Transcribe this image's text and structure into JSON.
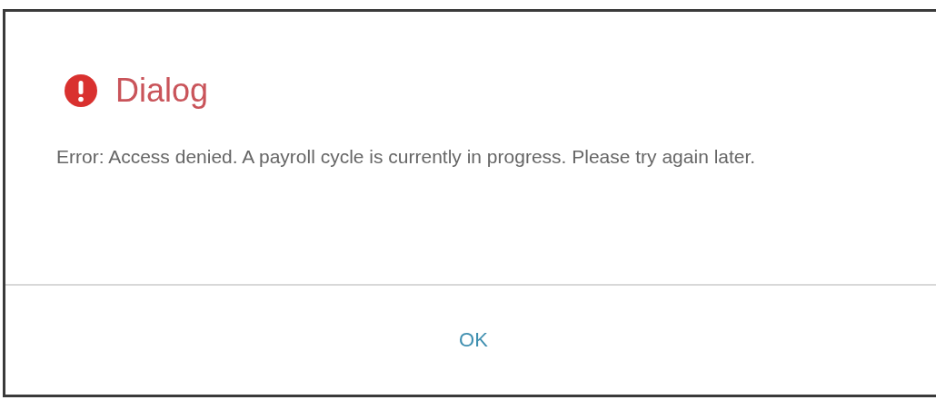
{
  "dialog": {
    "title": "Dialog",
    "message": "Error: Access denied. A payroll cycle is currently in progress. Please try again later.",
    "buttons": [
      "OK"
    ]
  }
}
